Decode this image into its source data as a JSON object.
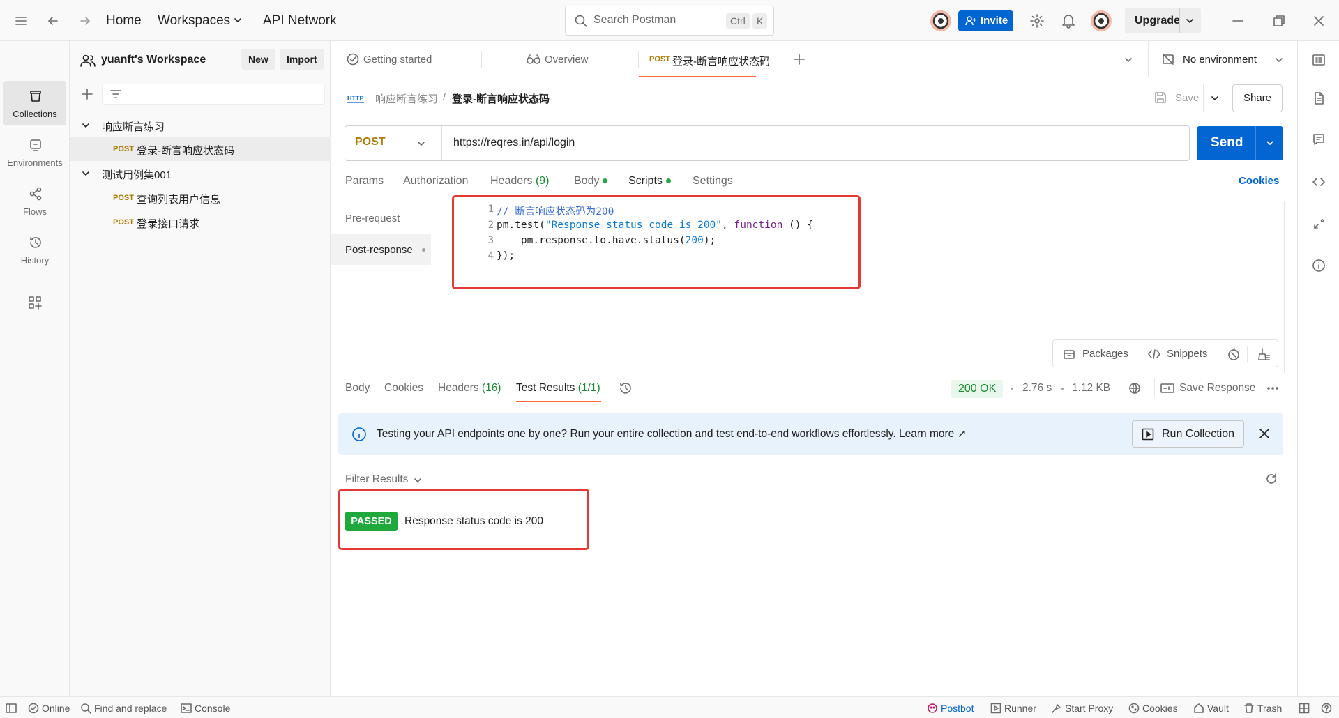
{
  "topbar": {
    "nav": {
      "home": "Home",
      "workspaces": "Workspaces",
      "api_network": "API Network"
    },
    "search": {
      "placeholder": "Search Postman",
      "shortcut_ctrl": "Ctrl",
      "shortcut_key": "K"
    },
    "invite_label": "Invite",
    "upgrade_label": "Upgrade"
  },
  "rail": {
    "items": [
      {
        "label": "Collections",
        "icon": "collections-icon"
      },
      {
        "label": "Environments",
        "icon": "environments-icon"
      },
      {
        "label": "Flows",
        "icon": "flows-icon"
      },
      {
        "label": "History",
        "icon": "history-icon"
      }
    ]
  },
  "sidebar": {
    "workspace_name": "yuanft's Workspace",
    "new_label": "New",
    "import_label": "Import",
    "tree": [
      {
        "type": "folder",
        "label": "响应断言练习"
      },
      {
        "type": "request",
        "method": "POST",
        "label": "登录-断言响应状态码",
        "selected": true
      },
      {
        "type": "folder",
        "label": "测试用例集001"
      },
      {
        "type": "request",
        "method": "POST",
        "label": "查询列表用户信息"
      },
      {
        "type": "request",
        "method": "POST",
        "label": "登录接口请求"
      }
    ]
  },
  "tabs": {
    "items": [
      {
        "label": "Getting started"
      },
      {
        "label": "Overview"
      },
      {
        "method": "POST",
        "label": "登录-断言响应状态码",
        "active": true
      }
    ],
    "environment": "No environment"
  },
  "request": {
    "breadcrumb_parent": "响应断言练习",
    "breadcrumb_sep": "/",
    "breadcrumb_current": "登录-断言响应状态码",
    "save_label": "Save",
    "share_label": "Share",
    "method": "POST",
    "url": "https://reqres.in/api/login",
    "send_label": "Send",
    "tabs": [
      "Params",
      "Authorization",
      "Headers",
      "Body",
      "Scripts",
      "Settings"
    ],
    "headers_count": "(9)",
    "cookies_label": "Cookies"
  },
  "scripts": {
    "pre_request": "Pre-request",
    "post_response": "Post-response",
    "line_numbers": [
      "1",
      "2",
      "3",
      "4"
    ],
    "code": {
      "l1": "// 断言响应状态码为200",
      "l2a": "pm.test(",
      "l2b": "\"Response status code is 200\"",
      "l2c": ", ",
      "l2d": "function",
      "l2e": " () {",
      "l3a": "    pm.response.to.have.status(",
      "l3b": "200",
      "l3c": ");",
      "l4": "});"
    },
    "packages_label": "Packages",
    "snippets_label": "Snippets"
  },
  "response": {
    "tabs": {
      "body": "Body",
      "cookies": "Cookies",
      "headers": "Headers",
      "headers_count": "(16)",
      "test_results": "Test Results",
      "test_results_count": "(1/1)"
    },
    "status": "200 OK",
    "time": "2.76 s",
    "size": "1.12 KB",
    "save_response": "Save Response",
    "banner_text": "Testing your API endpoints one by one? Run your entire collection and test end-to-end workflows effortlessly.",
    "learn_more": "Learn more",
    "run_collection": "Run Collection",
    "filter_results": "Filter Results",
    "result_badge": "PASSED",
    "result_text": "Response status code is 200"
  },
  "footer": {
    "online": "Online",
    "find_replace": "Find and replace",
    "console": "Console",
    "postbot": "Postbot",
    "runner": "Runner",
    "start_proxy": "Start Proxy",
    "cookies": "Cookies",
    "vault": "Vault",
    "trash": "Trash"
  },
  "colors": {
    "accent": "#0265d2",
    "post": "#ad7a03",
    "tab_active": "#ff6c37",
    "passed": "#1fa83c",
    "highlight_box": "#e53935"
  }
}
